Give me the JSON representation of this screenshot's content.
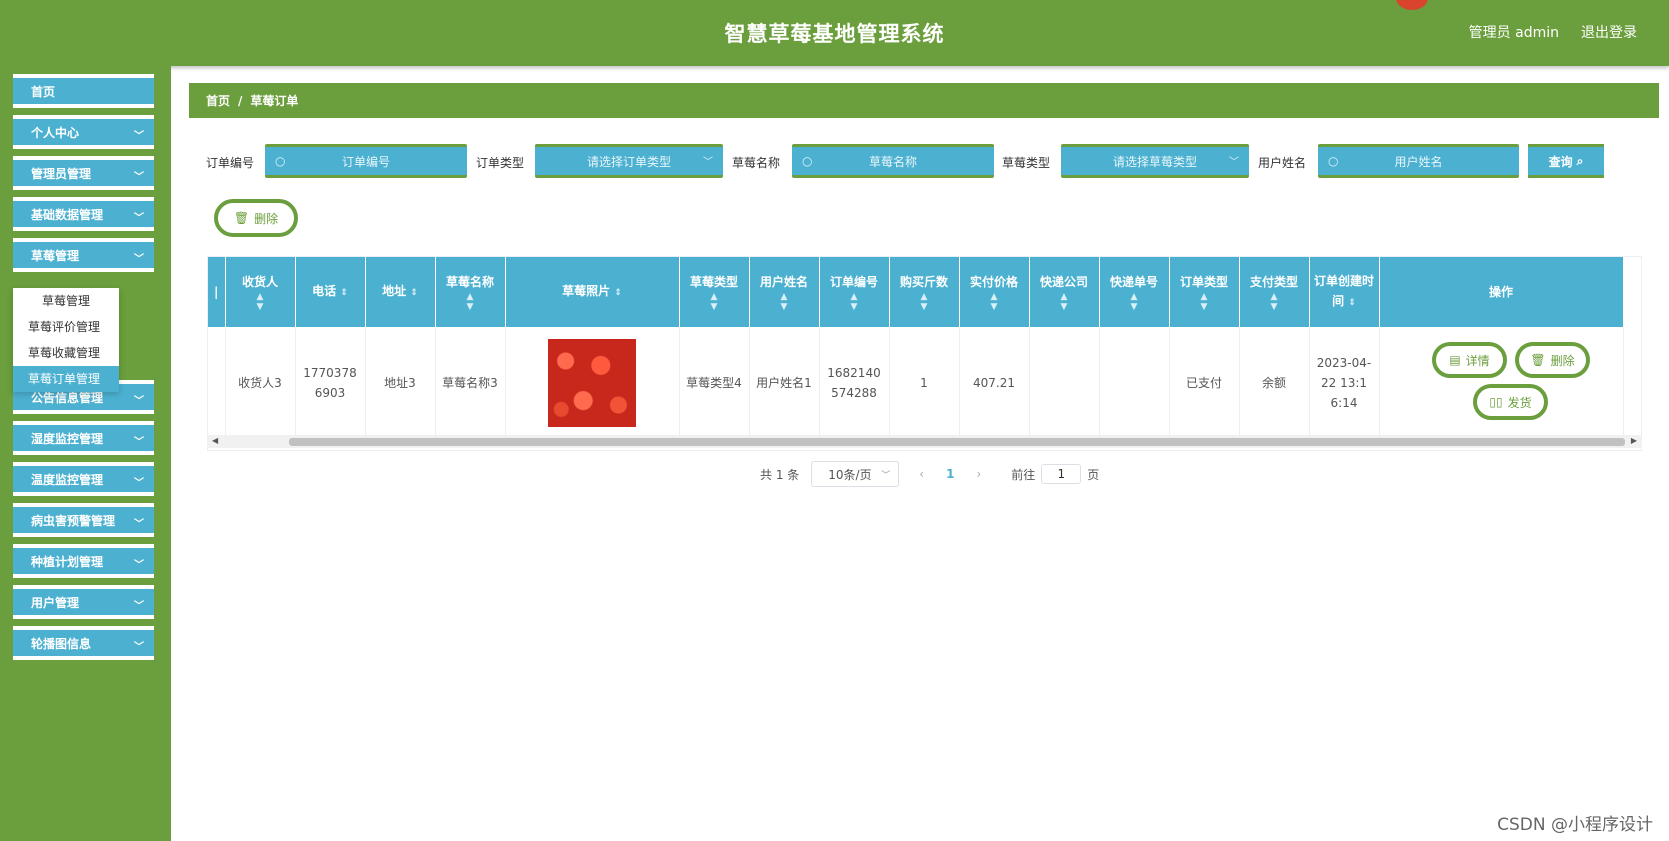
{
  "header": {
    "title": "智慧草莓基地管理系统",
    "admin_label": "管理员 admin",
    "logout_label": "退出登录"
  },
  "sidebar": {
    "items": [
      {
        "label": "首页",
        "has_chevron": false
      },
      {
        "label": "个人中心",
        "has_chevron": true
      },
      {
        "label": "管理员管理",
        "has_chevron": true
      },
      {
        "label": "基础数据管理",
        "has_chevron": true
      },
      {
        "label": "草莓管理",
        "has_chevron": true
      },
      {
        "label": "公告信息管理",
        "has_chevron": true
      },
      {
        "label": "湿度监控管理",
        "has_chevron": true
      },
      {
        "label": "温度监控管理",
        "has_chevron": true
      },
      {
        "label": "病虫害预警管理",
        "has_chevron": true
      },
      {
        "label": "种植计划管理",
        "has_chevron": true
      },
      {
        "label": "用户管理",
        "has_chevron": true
      },
      {
        "label": "轮播图信息",
        "has_chevron": true
      }
    ],
    "submenu": [
      "草莓管理",
      "草莓评价管理",
      "草莓收藏管理",
      "草莓订单管理"
    ],
    "active_submenu": "草莓订单管理"
  },
  "breadcrumb": {
    "home": "首页",
    "separator": "/",
    "current": "草莓订单"
  },
  "filters": {
    "order_no_label": "订单编号",
    "order_no_placeholder": "订单编号",
    "order_type_label": "订单类型",
    "order_type_placeholder": "请选择订单类型",
    "name_label": "草莓名称",
    "name_placeholder": "草莓名称",
    "category_label": "草莓类型",
    "category_placeholder": "请选择草莓类型",
    "user_label": "用户姓名",
    "user_placeholder": "用户姓名",
    "query_label": "查询"
  },
  "actions": {
    "bulk_delete_label": "删除"
  },
  "table": {
    "headers": [
      "收货人",
      "电话",
      "地址",
      "草莓名称",
      "草莓照片",
      "草莓类型",
      "用户姓名",
      "订单编号",
      "购买斤数",
      "实付价格",
      "快递公司",
      "快递单号",
      "订单类型",
      "支付类型",
      "订单创建时间",
      "操作"
    ],
    "partial_header": "|",
    "rows": [
      {
        "receiver": "收货人3",
        "phone": "17703786903",
        "address": "地址3",
        "name": "草莓名称3",
        "category": "草莓类型4",
        "username": "用户姓名1",
        "order_no": "1682140574288",
        "quantity": "1",
        "price": "407.21",
        "express_company": "",
        "express_no": "",
        "order_type": "已支付",
        "pay_type": "余额",
        "created": "2023-04-22 13:16:14",
        "detail_label": "详情",
        "delete_label": "删除",
        "ship_label": "发货"
      }
    ]
  },
  "pagination": {
    "total_label": "共 1 条",
    "page_size_label": "10条/页",
    "prev": "‹",
    "current_page": "1",
    "next": "›",
    "goto_label": "前往",
    "goto_value": "1",
    "page_suffix": "页"
  },
  "watermark": "CSDN @小程序设计",
  "colors": {
    "primary_green": "#6b9e3c",
    "primary_blue": "#4cb1d1"
  }
}
